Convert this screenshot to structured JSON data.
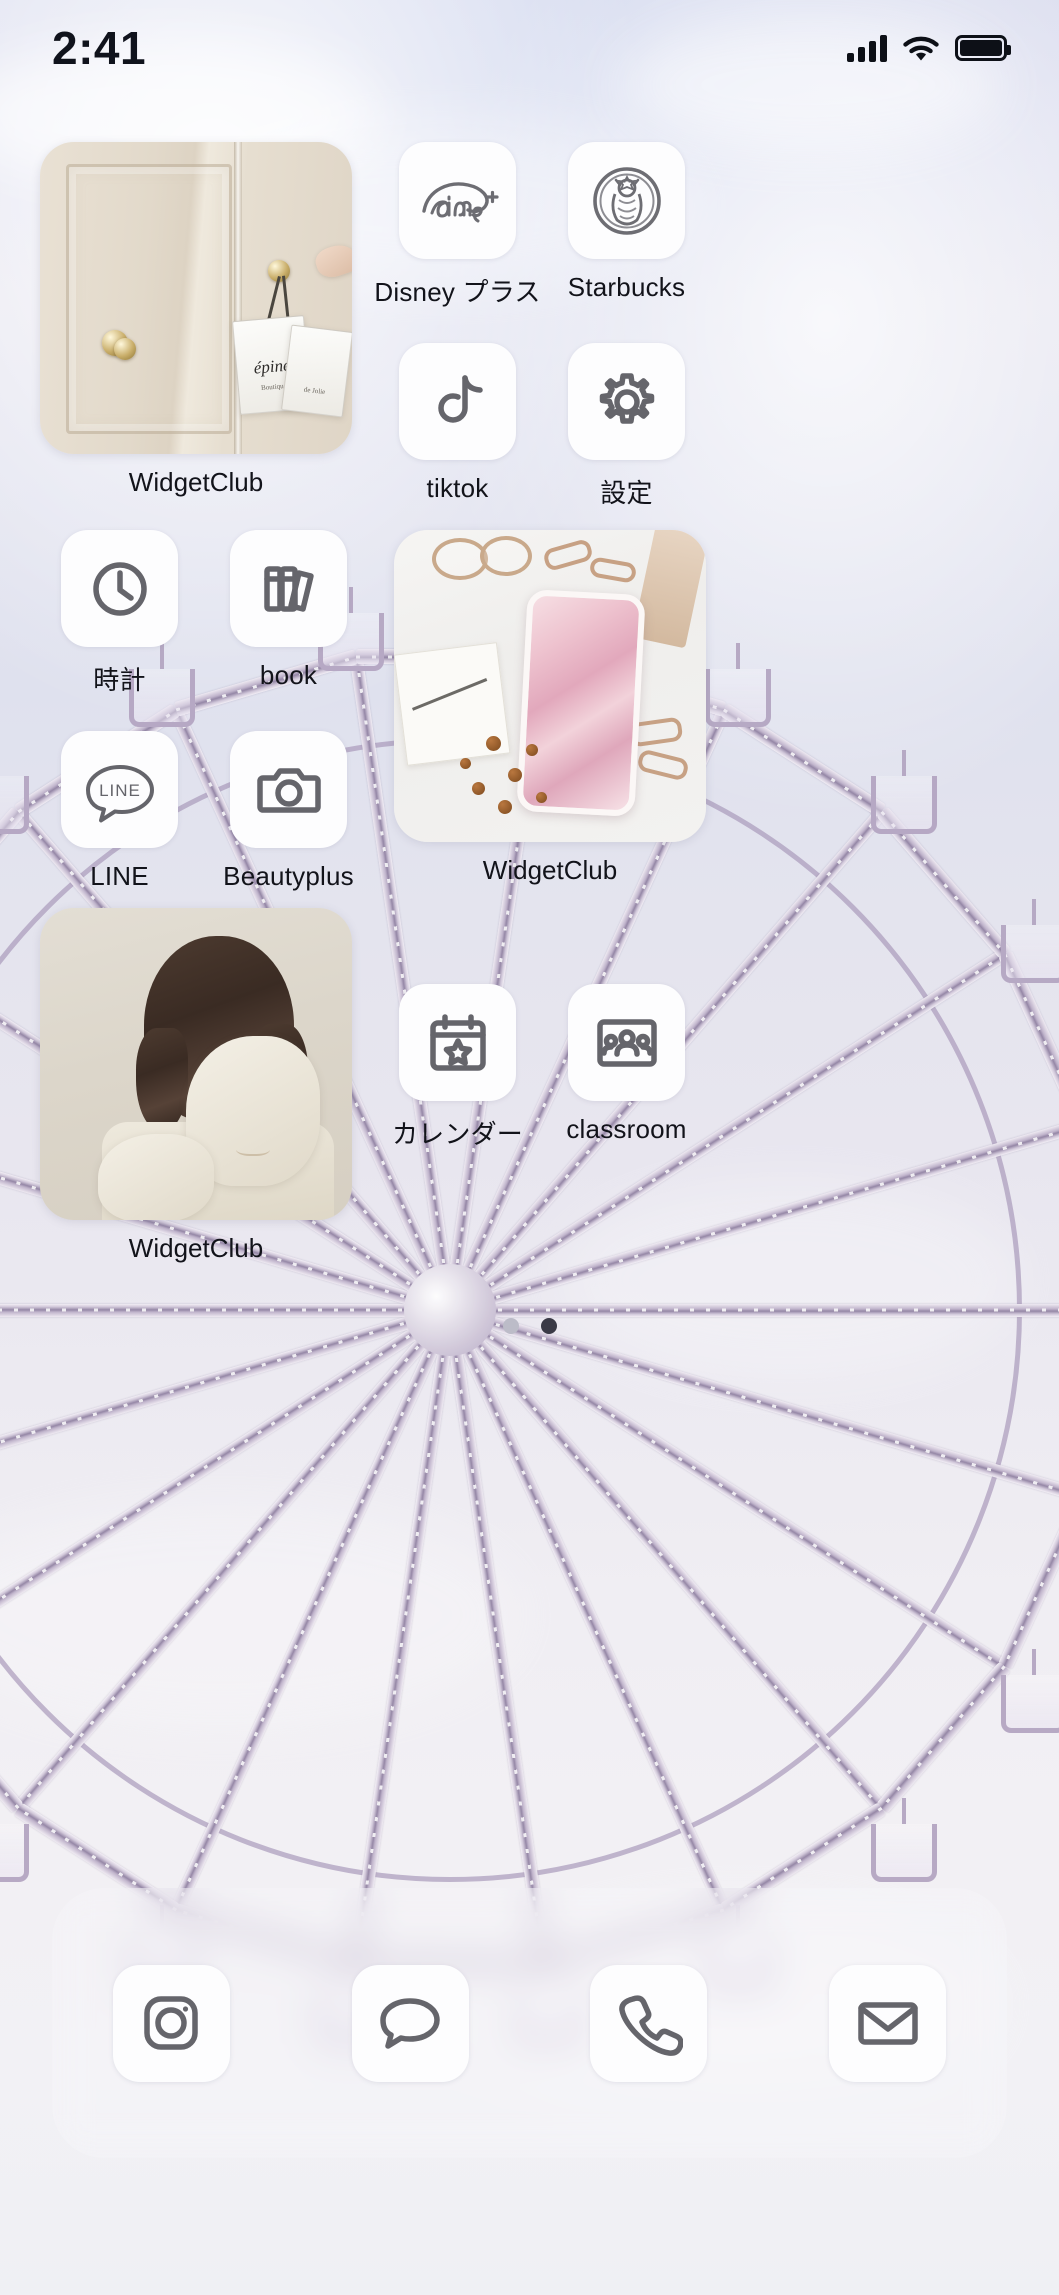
{
  "status_bar": {
    "time": "2:41",
    "cellular_icon": "signal-bars-icon",
    "wifi_icon": "wifi-icon",
    "battery_icon": "battery-full-icon"
  },
  "home_screen": {
    "widgets": [
      {
        "id": "widget-door",
        "label": "WidgetClub",
        "art": "cream-door-with-shopping-bags",
        "bag_text": "épine",
        "bag_sub": "Boutique de Jolie"
      },
      {
        "id": "widget-desk",
        "label": "WidgetClub",
        "art": "pink-marble-phone-flatlay"
      },
      {
        "id": "widget-girl",
        "label": "WidgetClub",
        "art": "girl-in-cream-sweater"
      }
    ],
    "apps": [
      {
        "label": "Disney プラス",
        "icon": "disney-plus-icon"
      },
      {
        "label": "Starbucks",
        "icon": "starbucks-siren-icon"
      },
      {
        "label": "tiktok",
        "icon": "tiktok-note-icon"
      },
      {
        "label": "設定",
        "icon": "gear-icon"
      },
      {
        "label": "時計",
        "icon": "clock-icon"
      },
      {
        "label": "book",
        "icon": "books-icon"
      },
      {
        "label": "LINE",
        "icon": "line-chat-icon"
      },
      {
        "label": "Beautyplus",
        "icon": "camera-icon"
      },
      {
        "label": "カレンダー",
        "icon": "calendar-star-icon"
      },
      {
        "label": "classroom",
        "icon": "classroom-people-icon"
      }
    ],
    "line_icon_text": "LINE",
    "page_dots": {
      "count": 2,
      "active_index": 1
    }
  },
  "dock": {
    "items": [
      {
        "name": "instagram",
        "icon": "instagram-icon"
      },
      {
        "name": "messages",
        "icon": "message-bubble-icon"
      },
      {
        "name": "phone",
        "icon": "phone-handset-icon"
      },
      {
        "name": "mail",
        "icon": "mail-envelope-icon"
      }
    ]
  },
  "colors": {
    "background": "#dfe0ef",
    "icon_tile": "#fdfdfe",
    "glyph_stroke": "#65656b",
    "label_text": "#12131a",
    "dot_inactive": "#bcbcc8",
    "dot_active": "#3a3a46"
  }
}
